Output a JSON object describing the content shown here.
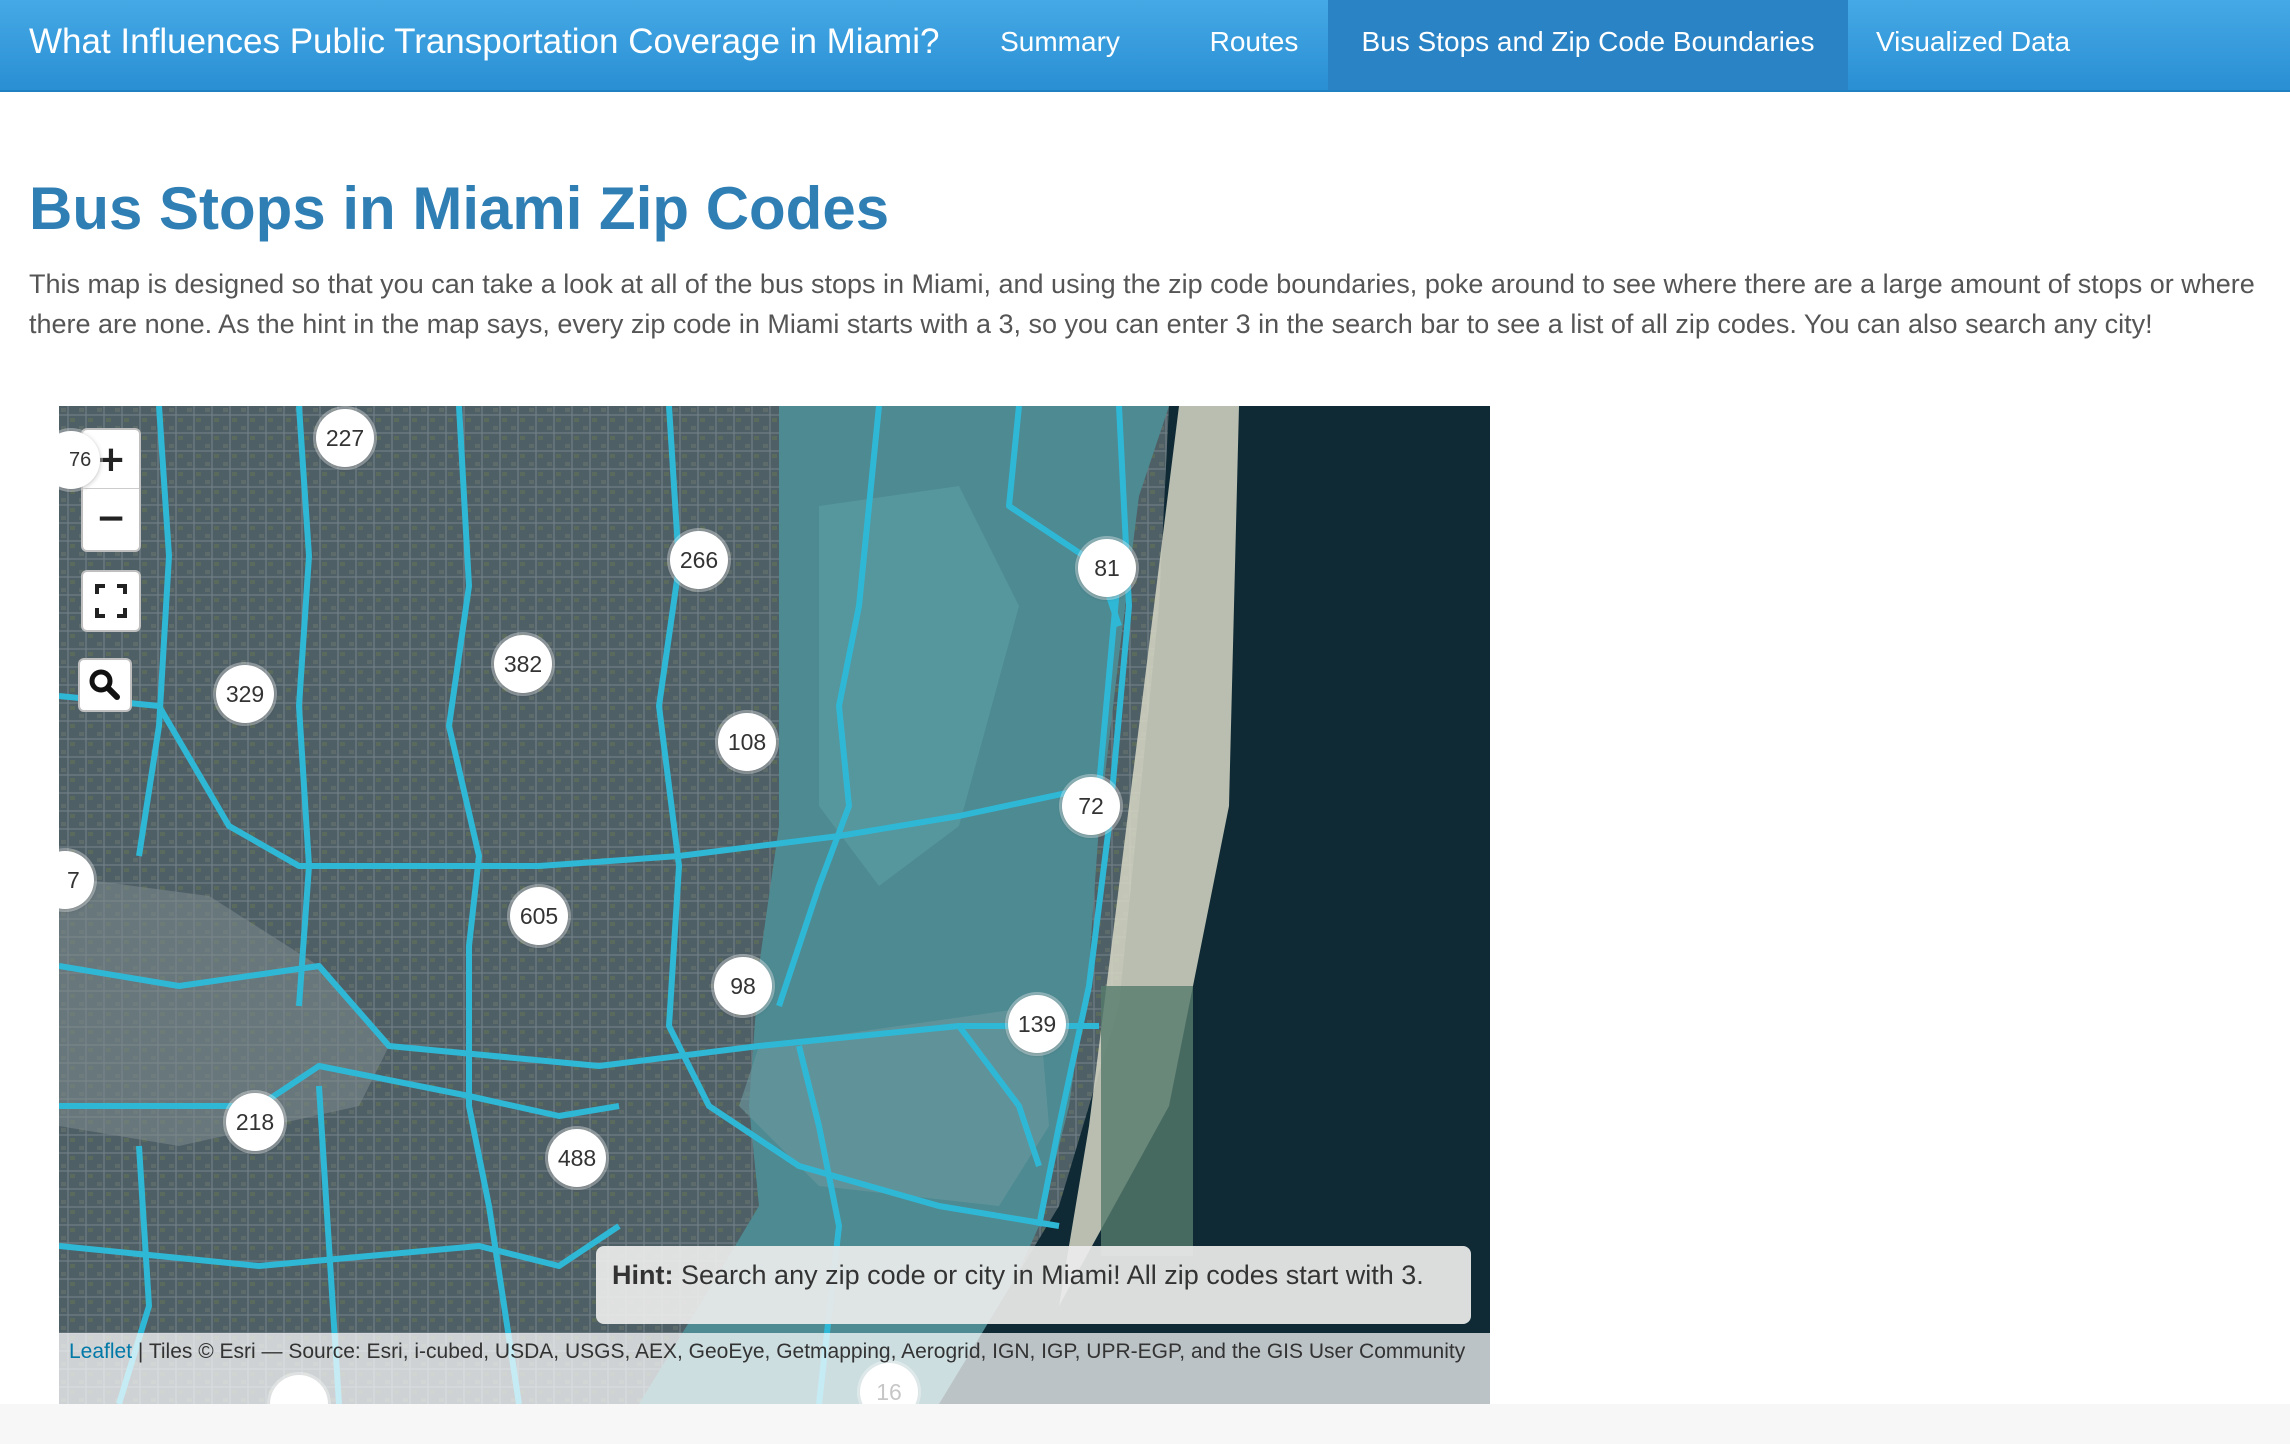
{
  "navbar": {
    "brand": "What Influences Public Transportation Coverage in Miami?",
    "items": [
      {
        "label": "Summary",
        "active": false
      },
      {
        "label": "Routes",
        "active": false
      },
      {
        "label": "Bus Stops and Zip Code Boundaries",
        "active": true
      },
      {
        "label": "Visualized Data",
        "active": false
      }
    ]
  },
  "page": {
    "title": "Bus Stops in Miami Zip Codes",
    "intro": "This map is designed so that you can take a look at all of the bus stops in Miami, and using the zip code boundaries, poke around to see where there are a large amount of stops or where there are none. As the hint in the map says, every zip code in Miami starts with a 3, so you can enter 3 in the search bar to see a list of all zip codes. You can also search any city!"
  },
  "map": {
    "controls": {
      "zoom_in": "+",
      "zoom_out": "−"
    },
    "icons": [
      "zoom-in-icon",
      "zoom-out-icon",
      "fullscreen-icon",
      "search-icon"
    ],
    "boundary_color": "#2fb8d6",
    "clusters": [
      "227",
      "266",
      "81",
      "382",
      "329",
      "108",
      "72",
      "605",
      "98",
      "139",
      "218",
      "488",
      "16",
      "7",
      "76"
    ],
    "hint_label": "Hint:",
    "hint_text": "Search any zip code or city in Miami! All zip codes start with 3.",
    "attribution_link": "Leaflet",
    "attribution_text": "| Tiles © Esri — Source: Esri, i-cubed, USDA, USGS, AEX, GeoEye, Getmapping, Aerogrid, IGN, IGP, UPR-EGP, and the GIS User Community"
  }
}
